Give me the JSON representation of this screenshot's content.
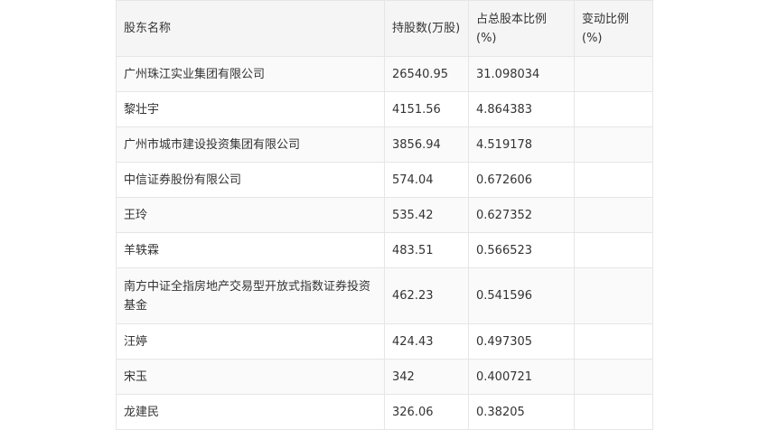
{
  "table": {
    "headers": [
      "股东名称",
      "持股数(万股)",
      "占总股本比例(%)",
      "变动比例(%)"
    ],
    "rows": [
      [
        "广州珠江实业集团有限公司",
        "26540.95",
        "31.098034",
        ""
      ],
      [
        "黎壮宇",
        "4151.56",
        "4.864383",
        ""
      ],
      [
        "广州市城市建设投资集团有限公司",
        "3856.94",
        "4.519178",
        ""
      ],
      [
        "中信证券股份有限公司",
        "574.04",
        "0.672606",
        ""
      ],
      [
        "王玲",
        "535.42",
        "0.627352",
        ""
      ],
      [
        "羊轶霖",
        "483.51",
        "0.566523",
        ""
      ],
      [
        "南方中证全指房地产交易型开放式指数证券投资基金",
        "462.23",
        "0.541596",
        ""
      ],
      [
        "汪婷",
        "424.43",
        "0.497305",
        ""
      ],
      [
        "宋玉",
        "342",
        "0.400721",
        ""
      ],
      [
        "龙建民",
        "326.06",
        "0.38205",
        ""
      ]
    ]
  }
}
